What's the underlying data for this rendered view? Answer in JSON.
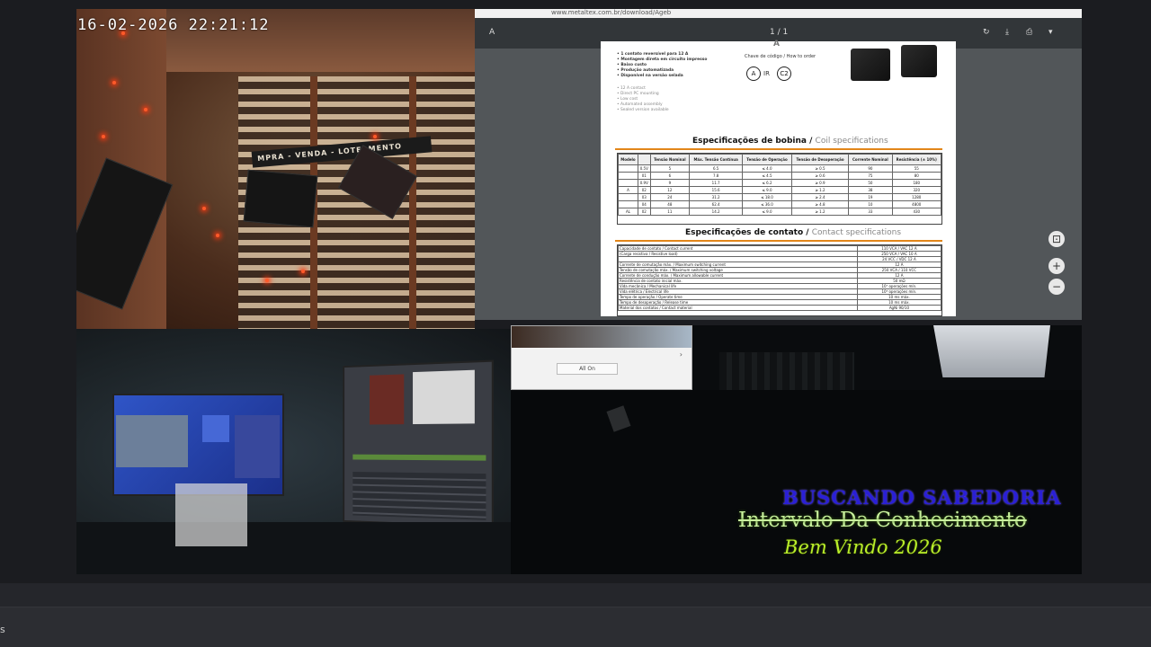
{
  "camera": {
    "timestamp": "16-02-2026  22:21:12",
    "sign_text": "MPRA - VENDA - LOTEAMENTO"
  },
  "pdf_viewer": {
    "url": "www.metaltex.com.br/download/Ageb",
    "toolbar": {
      "nav_letter": "A",
      "page_indicator": "1 / 1",
      "icons": [
        "rotate-icon",
        "download-icon",
        "print-icon",
        "bookmark-icon"
      ]
    },
    "zoom": {
      "fit": "⊡",
      "in": "+",
      "out": "−"
    },
    "document": {
      "series_letter": "A",
      "features_pt": [
        "• 1 contato reversível para 12 A",
        "• Montagem direta em circuito impresso",
        "• Baixo custo",
        "• Produção automatizada",
        "• Disponível na versão selada"
      ],
      "features_en": [
        "• 12 A contact",
        "• Direct PC mounting",
        "• Low cost",
        "• Automated assembly",
        "• Sealed version available"
      ],
      "order_code_label": "Chave de código / How to order",
      "order_code_parts": [
        "A",
        "IR",
        "C2"
      ],
      "coil_heading": "Especificações de bobina /",
      "coil_heading_en": "Coil specifications",
      "coil_columns": [
        "Modelo",
        "",
        "Tensão Nominal",
        "Máx. Tensão Contínua",
        "Tensão de Operação",
        "Tensão de Desoperação",
        "Corrente Nominal",
        "Resistência (± 10%)"
      ],
      "coil_rows": [
        [
          "",
          "0.5V",
          "5",
          "6.5",
          "≤ 4.0",
          "≥ 0.5",
          "90",
          "55"
        ],
        [
          "",
          "01",
          "6",
          "7.8",
          "≤ 4.5",
          "≥ 0.6",
          "75",
          "80"
        ],
        [
          "",
          "0.9V",
          "9",
          "11.7",
          "≤ 6.2",
          "≥ 0.9",
          "50",
          "180"
        ],
        [
          "A",
          "02",
          "12",
          "15.6",
          "≤ 9.0",
          "≥ 1.2",
          "38",
          "320"
        ],
        [
          "",
          "03",
          "24",
          "31.2",
          "≤ 18.0",
          "≥ 2.4",
          "19",
          "1280"
        ],
        [
          "",
          "04",
          "48",
          "62.4",
          "≤ 36.0",
          "≥ 4.8",
          "10",
          "4800"
        ],
        [
          "AL",
          "02",
          "11",
          "14.2",
          "≤ 9.0",
          "≥ 1.2",
          "33",
          "430"
        ]
      ],
      "contact_heading": "Especificações de contato /",
      "contact_heading_en": "Contact specifications",
      "contact_rows": [
        [
          "Capacidade de contato / Contact current",
          "110 VCA / VAC 12 A"
        ],
        [
          "(Carga resistiva / Resistive load)",
          "250 VCA / VAC 10 A"
        ],
        [
          "",
          "24 VCC / VDC 12 A"
        ],
        [
          "Corrente de comutação máx. / Maximum switching current",
          "12 A"
        ],
        [
          "Tensão de comutação máx. / Maximum switching voltage",
          "250 VCA / 110 VCC"
        ],
        [
          "Corrente de condução máx. / Maximum allowable current",
          "12 A"
        ],
        [
          "Resistência de contato inicial máx.",
          "50 mΩ"
        ],
        [
          "Vida mecânica / Mechanical life",
          "10⁷ operações mín."
        ],
        [
          "Vida elétrica / Electrical life",
          "10⁵ operações mín."
        ],
        [
          "Tempo de operação / Operate time",
          "10 ms máx."
        ],
        [
          "Tempo de desoperação / Release time",
          "10 ms máx."
        ],
        [
          "Material dos contatos / Contact material",
          "AgNi 90/10"
        ]
      ]
    }
  },
  "popup": {
    "button_label": "All On",
    "arrow": "›"
  },
  "overlay": {
    "line1": "BUSCANDO SABEDORIA",
    "line2": "Intervalo Da Conhecimento",
    "line3": "Bem Vindo 2026"
  },
  "bottom": {
    "label": "s"
  }
}
